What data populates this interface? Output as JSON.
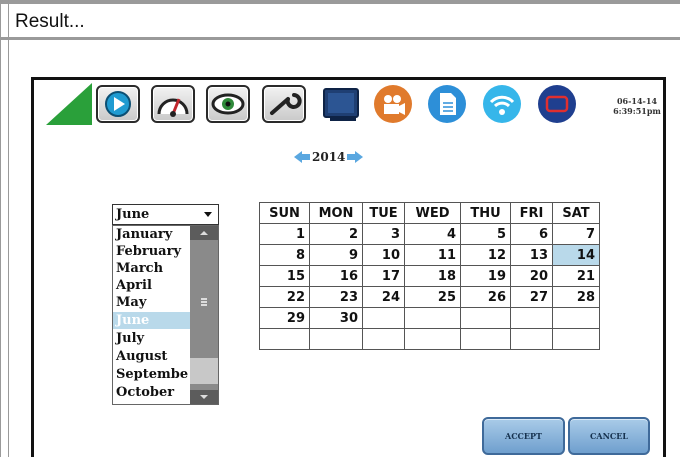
{
  "header": {
    "title": "Result..."
  },
  "toolbar": {
    "icons": [
      "play-icon",
      "gauge-icon",
      "eye-icon",
      "wrench-icon",
      "monitor-icon",
      "camera-icon",
      "document-icon",
      "wifi-icon",
      "screen-icon"
    ],
    "datetime": {
      "date": "06-14-14",
      "time": "6:39:51pm"
    }
  },
  "year_nav": {
    "year": "2014"
  },
  "month_select": {
    "selected": "June",
    "options": [
      "January",
      "February",
      "March",
      "April",
      "May",
      "June",
      "July",
      "August",
      "Septembe",
      "October"
    ]
  },
  "calendar": {
    "headers": [
      "SUN",
      "MON",
      "TUE",
      "WED",
      "THU",
      "FRI",
      "SAT"
    ],
    "rows": [
      [
        "1",
        "2",
        "3",
        "4",
        "5",
        "6",
        "7"
      ],
      [
        "8",
        "9",
        "10",
        "11",
        "12",
        "13",
        "14"
      ],
      [
        "15",
        "16",
        "17",
        "18",
        "19",
        "20",
        "21"
      ],
      [
        "22",
        "23",
        "24",
        "25",
        "26",
        "27",
        "28"
      ],
      [
        "29",
        "30",
        "",
        "",
        "",
        "",
        ""
      ],
      [
        "",
        "",
        "",
        "",
        "",
        "",
        ""
      ]
    ],
    "selected_day": "14"
  },
  "buttons": {
    "accept": "ACCEPT",
    "cancel": "CANCEL"
  },
  "colors": {
    "accent": "#5aa7e0",
    "highlight": "#b9d9ea",
    "logo_green": "#2aa03a",
    "button_blue": "#6f9fce"
  }
}
